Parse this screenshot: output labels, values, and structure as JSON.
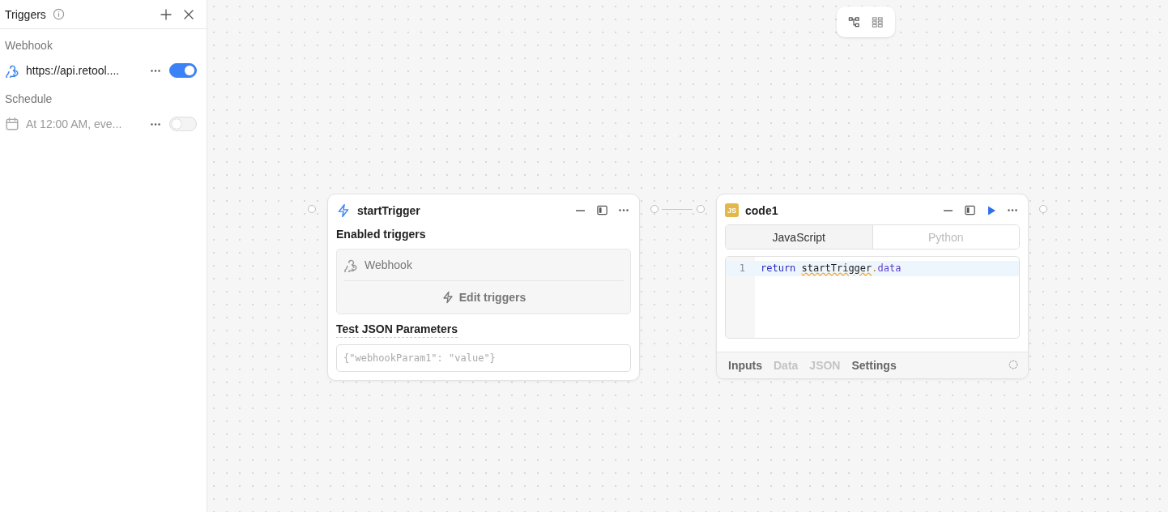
{
  "sidebar": {
    "title": "Triggers",
    "sections": [
      {
        "heading": "Webhook",
        "kind": "webhook",
        "label": "https://api.retool....",
        "on": true
      },
      {
        "heading": "Schedule",
        "kind": "schedule",
        "label": "At 12:00 AM, eve...",
        "on": false
      }
    ]
  },
  "trigger_node": {
    "title": "startTrigger",
    "enabled_label": "Enabled triggers",
    "triggers": [
      "Webhook"
    ],
    "edit_button": "Edit triggers",
    "params_label": "Test JSON Parameters",
    "params_placeholder": "{\"webhookParam1\": \"value\"}"
  },
  "code_node": {
    "badge": "JS",
    "title": "code1",
    "languages": [
      {
        "label": "JavaScript",
        "selected": true
      },
      {
        "label": "Python",
        "selected": false
      }
    ],
    "lines": [
      {
        "number": "1",
        "tokens": [
          {
            "kind": "keyword",
            "text": "return"
          },
          {
            "kind": "identifier",
            "text": "startTrigger"
          },
          {
            "kind": "punct",
            "text": "."
          },
          {
            "kind": "property",
            "text": "data"
          }
        ]
      }
    ],
    "footer_tabs": [
      {
        "label": "Inputs",
        "disabled": false
      },
      {
        "label": "Data",
        "disabled": true
      },
      {
        "label": "JSON",
        "disabled": true
      },
      {
        "label": "Settings",
        "disabled": false
      }
    ]
  }
}
